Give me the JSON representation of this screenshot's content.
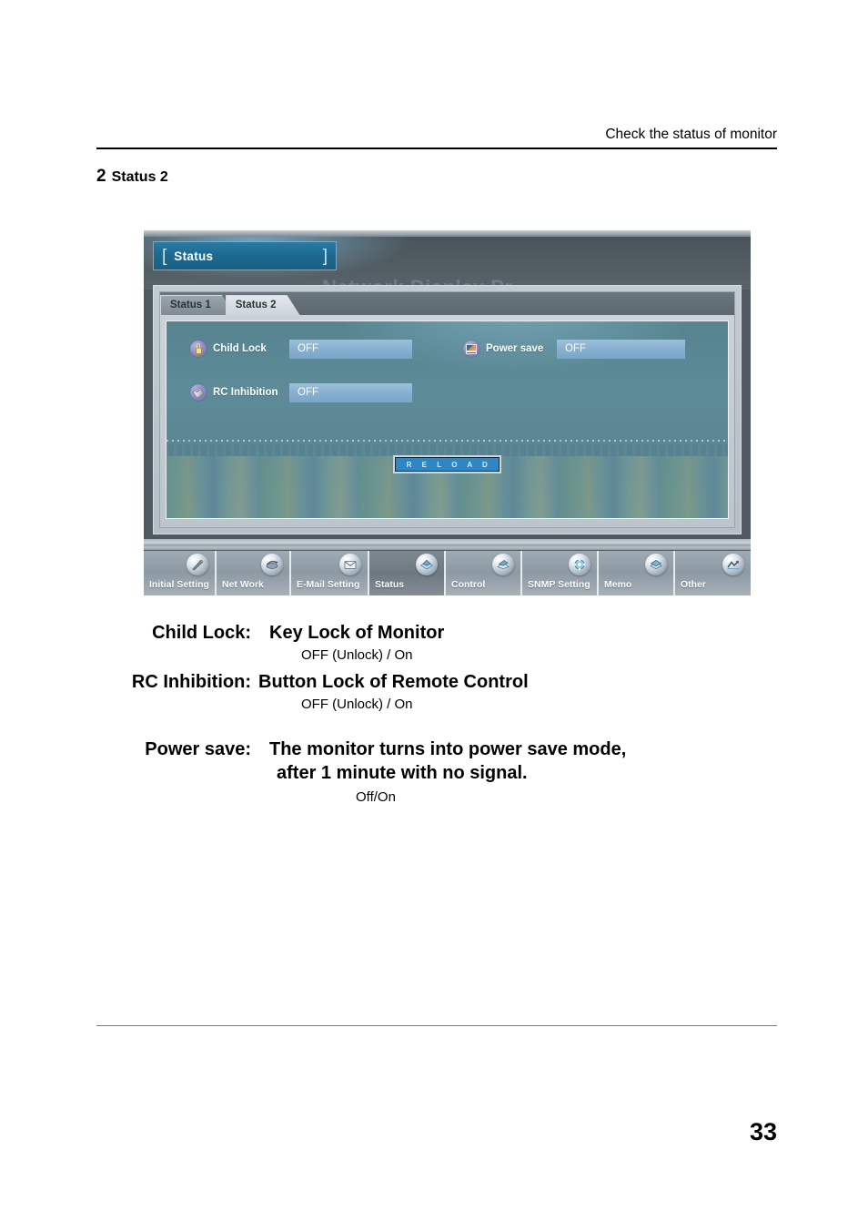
{
  "page": {
    "running_head": "Check the status of monitor",
    "section_number": "2",
    "section_title": "Status 2",
    "page_number": "33"
  },
  "screenshot": {
    "title_plate": {
      "bracket_left": "[",
      "label": "Status",
      "bracket_right": "]"
    },
    "ghost_background_text": "Network Display Pr",
    "tabs": [
      {
        "label": "Status 1",
        "active": false
      },
      {
        "label": "Status 2",
        "active": true
      }
    ],
    "form": {
      "rows": [
        {
          "icon": "padlock-icon",
          "label": "Child Lock",
          "value": "OFF"
        },
        {
          "icon": "monitor-power-save-icon",
          "label": "Power save",
          "value": "OFF"
        },
        {
          "icon": "remote-control-icon",
          "label": "RC Inhibition",
          "value": "OFF"
        }
      ]
    },
    "reload_button": "R E L O A D",
    "nav_items": [
      {
        "label": "Initial Setting",
        "icon": "pen-icon",
        "active": false
      },
      {
        "label": "Net Work",
        "icon": "network-icon",
        "active": false
      },
      {
        "label": "E-Mail Setting",
        "icon": "envelope-icon",
        "active": false
      },
      {
        "label": "Status",
        "icon": "status-icon",
        "active": true
      },
      {
        "label": "Control",
        "icon": "control-icon",
        "active": false
      },
      {
        "label": "SNMP Setting",
        "icon": "snmp-icon",
        "active": false
      },
      {
        "label": "Memo",
        "icon": "memo-icon",
        "active": false
      },
      {
        "label": "Other",
        "icon": "other-icon",
        "active": false
      }
    ],
    "colors": {
      "title_plate": "#1d6a92",
      "panel_background": "#5d8b97",
      "value_field": "#88b0d0",
      "reload_button": "#2f86c4",
      "nav_active": "#6d7880",
      "window_chrome": "#4e5a60"
    }
  },
  "descriptions": [
    {
      "term": "Child Lock:",
      "definition": "Key Lock of Monitor",
      "options": "OFF (Unlock) / On"
    },
    {
      "term": "RC Inhibition:",
      "definition": "Button Lock of Remote Control",
      "options": "OFF (Unlock) / On"
    }
  ],
  "power_save": {
    "term": "Power save:",
    "line1": "The monitor  turns into power save mode,",
    "line2": "after 1 minute with no signal.",
    "options": "Off/On"
  }
}
